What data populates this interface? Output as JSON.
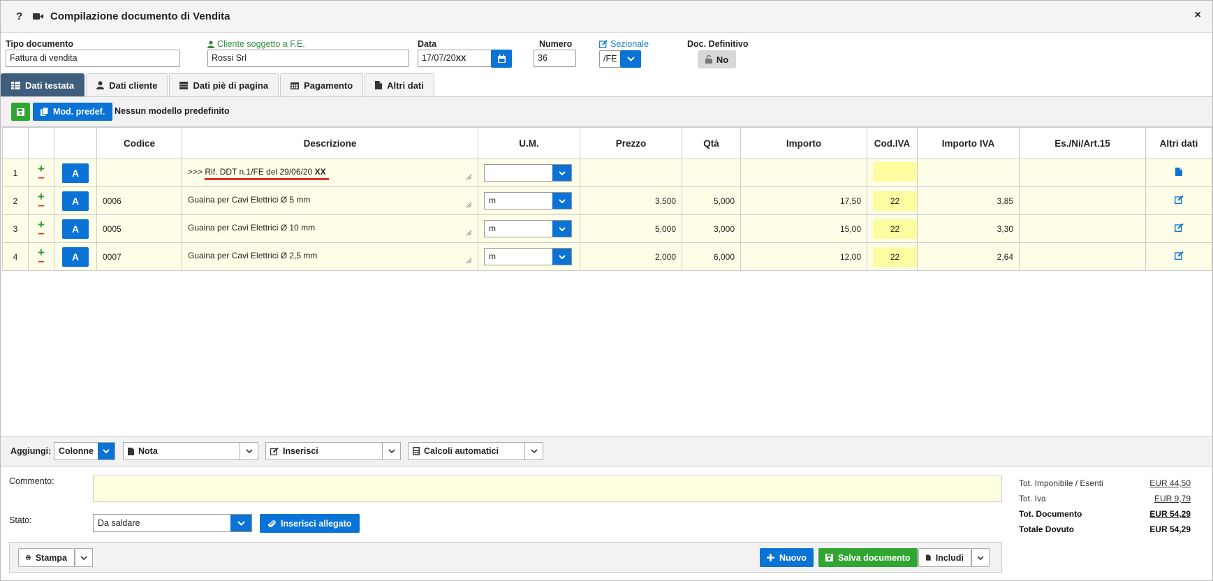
{
  "window": {
    "title": "Compilazione documento di Vendita",
    "help": "?",
    "close": "×"
  },
  "header": {
    "tipo_label": "Tipo documento",
    "tipo_value": "Fattura di vendita",
    "cliente_label": "Cliente soggetto a F.E.",
    "cliente_value": "Rossi Srl",
    "data_label": "Data",
    "data_value": "17/07/20",
    "data_suffix": "XX",
    "numero_label": "Numero",
    "numero_value": "36",
    "sezionale_label": "Sezionale",
    "sezionale_value": "/FE",
    "definitivo_label": "Doc. Definitivo",
    "definitivo_value": "No"
  },
  "tabs": [
    {
      "label": "Dati testata",
      "icon": "table-icon"
    },
    {
      "label": "Dati cliente",
      "icon": "user-icon"
    },
    {
      "label": "Dati piè di pagina",
      "icon": "list-icon"
    },
    {
      "label": "Pagamento",
      "icon": "calendar-icon"
    },
    {
      "label": "Altri dati",
      "icon": "file-icon"
    }
  ],
  "toolbar": {
    "mod_label": "Mod. predef.",
    "model_text": "Nessun modello predefinito"
  },
  "table": {
    "headers": [
      "Codice",
      "Descrizione",
      "U.M.",
      "Prezzo",
      "Qtà",
      "Importo",
      "Cod.IVA",
      "Importo IVA",
      "Es./Ni/Art.15",
      "Altri dati"
    ],
    "row_button": "A",
    "rows": [
      {
        "n": "1",
        "codice": "",
        "descrizione": ">>> Rif. DDT n.1/FE del 29/06/20",
        "desc_suffix": "XX",
        "um": "",
        "prezzo": "",
        "qta": "",
        "importo": "",
        "iva": "",
        "importo_iva": "",
        "es": ""
      },
      {
        "n": "2",
        "codice": "0006",
        "descrizione": "Guaina per Cavi Elettrici Ø 5 mm",
        "desc_suffix": "",
        "um": "m",
        "prezzo": "3,500",
        "qta": "5,000",
        "importo": "17,50",
        "iva": "22",
        "importo_iva": "3,85",
        "es": ""
      },
      {
        "n": "3",
        "codice": "0005",
        "descrizione": "Guaina per Cavi Elettrici Ø 10 mm",
        "desc_suffix": "",
        "um": "m",
        "prezzo": "5,000",
        "qta": "3,000",
        "importo": "15,00",
        "iva": "22",
        "importo_iva": "3,30",
        "es": ""
      },
      {
        "n": "4",
        "codice": "0007",
        "descrizione": "Guaina per Cavi Elettrici Ø 2,5 mm",
        "desc_suffix": "",
        "um": "m",
        "prezzo": "2,000",
        "qta": "6,000",
        "importo": "12,00",
        "iva": "22",
        "importo_iva": "2,64",
        "es": ""
      }
    ]
  },
  "addbar": {
    "label": "Aggiungi:",
    "colonne": "Colonne",
    "nota": "Nota",
    "inserisci": "Inserisci",
    "calcoli": "Calcoli automatici"
  },
  "footer": {
    "commento_label": "Commento:",
    "stato_label": "Stato:",
    "stato_value": "Da saldare",
    "allegato_label": "Inserisci allegato",
    "stampa": "Stampa",
    "nuovo": "Nuovo",
    "salva": "Salva documento",
    "includi": "Includi"
  },
  "totals": [
    {
      "label": "Tot. Imponibile / Esenti",
      "value": "EUR 44,50"
    },
    {
      "label": "Tot. Iva",
      "value": "EUR 9,79"
    },
    {
      "label": "Tot. Documento",
      "value": "EUR 54,29"
    },
    {
      "label": "Totale Dovuto",
      "value": "EUR 54,29"
    }
  ],
  "colors": {
    "accent": "#0a73d5",
    "success": "#31a532",
    "tab_active": "#3f5d7c",
    "row_bg": "#fefee8",
    "iva_bg": "#fdfca0"
  }
}
